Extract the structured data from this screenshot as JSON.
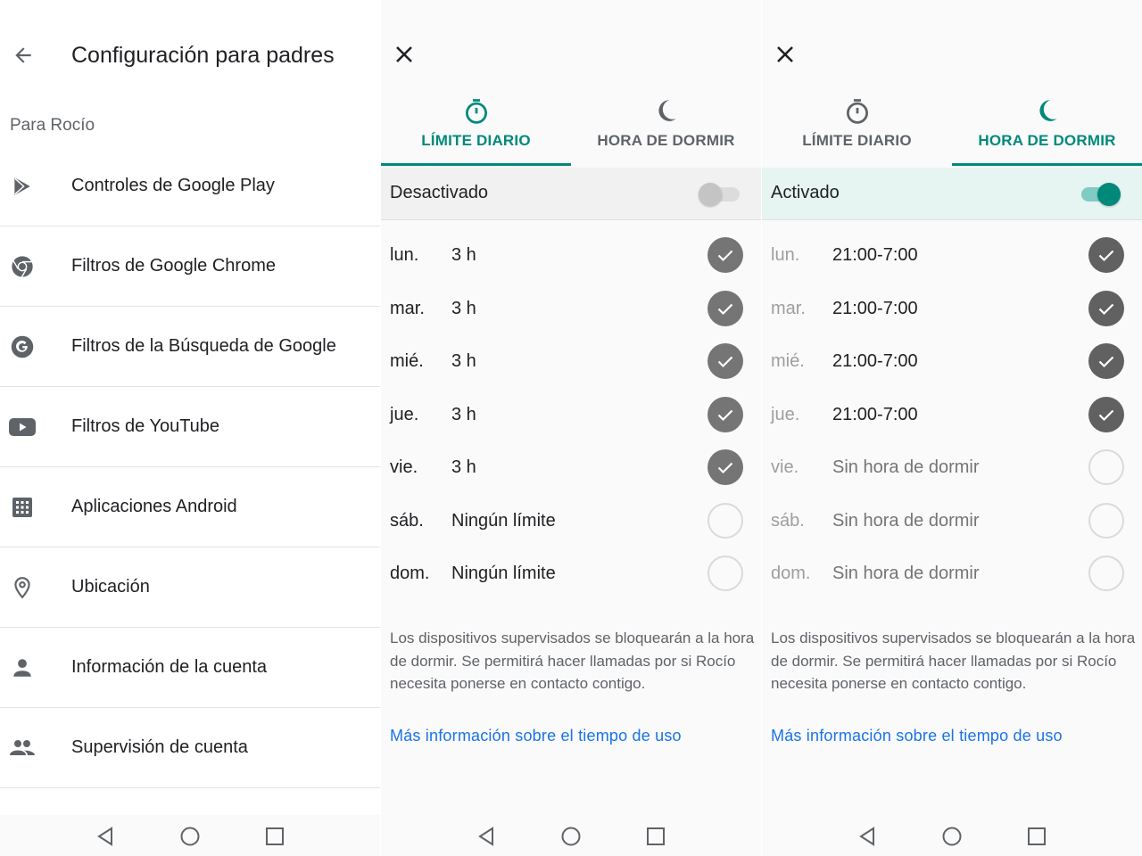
{
  "colors": {
    "accent": "#00897b",
    "link": "#1a73e8",
    "check_on": "#757575",
    "toggle_on_track": "#80cbc4",
    "toggle_off_track": "#e0e0e0",
    "active_bar_bg": "#e6f4f2"
  },
  "panel1": {
    "back_icon": "arrow-back-icon",
    "title": "Configuración para padres",
    "subtitle": "Para Rocío",
    "items": [
      {
        "label": "Controles de Google Play",
        "icon": "google-play-icon"
      },
      {
        "label": "Filtros de Google Chrome",
        "icon": "chrome-icon"
      },
      {
        "label": "Filtros de la Búsqueda de Google",
        "icon": "google-g-icon"
      },
      {
        "label": "Filtros de YouTube",
        "icon": "youtube-icon"
      },
      {
        "label": "Aplicaciones Android",
        "icon": "apps-grid-icon"
      },
      {
        "label": "Ubicación",
        "icon": "location-pin-icon"
      },
      {
        "label": "Información de la cuenta",
        "icon": "person-icon"
      },
      {
        "label": "Supervisión de cuenta",
        "icon": "people-icon"
      }
    ]
  },
  "panel2": {
    "close_icon": "close-icon",
    "tabs": [
      {
        "label": "LÍMITE DIARIO",
        "icon": "timer-icon",
        "active": true
      },
      {
        "label": "HORA DE DORMIR",
        "icon": "moon-icon",
        "active": false
      }
    ],
    "toggle": {
      "label": "Desactivado",
      "on": false
    },
    "days": [
      {
        "day": "lun.",
        "value": "3 h",
        "checked": true
      },
      {
        "day": "mar.",
        "value": "3 h",
        "checked": true
      },
      {
        "day": "mié.",
        "value": "3 h",
        "checked": true
      },
      {
        "day": "jue.",
        "value": "3 h",
        "checked": true
      },
      {
        "day": "vie.",
        "value": "3 h",
        "checked": true
      },
      {
        "day": "sáb.",
        "value": "Ningún límite",
        "checked": false
      },
      {
        "day": "dom.",
        "value": "Ningún límite",
        "checked": false
      }
    ],
    "info_lines": [
      "Los dispositivos supervisados se bloquearán a la hora",
      "de dormir. Se permitirá hacer llamadas por si Rocío",
      "necesita ponerse en contacto contigo."
    ],
    "link": "Más información sobre el tiempo de uso"
  },
  "panel3": {
    "close_icon": "close-icon",
    "tabs": [
      {
        "label": "LÍMITE DIARIO",
        "icon": "timer-icon",
        "active": false
      },
      {
        "label": "HORA DE DORMIR",
        "icon": "moon-icon",
        "active": true
      }
    ],
    "toggle": {
      "label": "Activado",
      "on": true
    },
    "days": [
      {
        "day": "lun.",
        "value": "21:00-7:00",
        "checked": true
      },
      {
        "day": "mar.",
        "value": "21:00-7:00",
        "checked": true
      },
      {
        "day": "mié.",
        "value": "21:00-7:00",
        "checked": true
      },
      {
        "day": "jue.",
        "value": "21:00-7:00",
        "checked": true
      },
      {
        "day": "vie.",
        "value": "Sin hora de dormir",
        "checked": false
      },
      {
        "day": "sáb.",
        "value": "Sin hora de dormir",
        "checked": false
      },
      {
        "day": "dom.",
        "value": "Sin hora de dormir",
        "checked": false
      }
    ],
    "info_lines": [
      "Los dispositivos supervisados se bloquearán a la hora",
      "de dormir. Se permitirá hacer llamadas por si Rocío",
      "necesita ponerse en contacto contigo."
    ],
    "link": "Más información sobre el tiempo de uso"
  },
  "navbar": {
    "buttons": [
      {
        "icon": "back-triangle-icon"
      },
      {
        "icon": "home-circle-icon"
      },
      {
        "icon": "recents-square-icon"
      }
    ]
  }
}
